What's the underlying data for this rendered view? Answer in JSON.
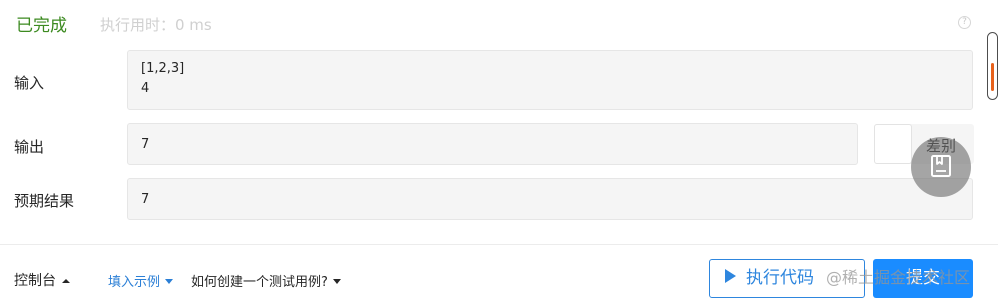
{
  "status": {
    "state": "已完成",
    "runtime": "执行用时：0 ms",
    "help_icon": "question-circle-icon"
  },
  "testcase": {
    "input_label": "输入",
    "input_lines": [
      "[1,2,3]",
      "4"
    ],
    "output_label": "输出",
    "output_value": "7",
    "expected_label": "预期结果",
    "expected_value": "7",
    "diff_label": "差别"
  },
  "toolbar": {
    "console_label": "控制台",
    "fill_example_label": "填入示例",
    "how_to_label": "如何创建一个测试用例?",
    "run_label": "执行代码",
    "submit_label": "提交",
    "watermark": "@稀土掘金技术社区"
  },
  "colors": {
    "success": "#3c8a20",
    "link": "#2b7fd6",
    "primary": "#1a8cff",
    "scroll_thumb": "#e8621c"
  }
}
